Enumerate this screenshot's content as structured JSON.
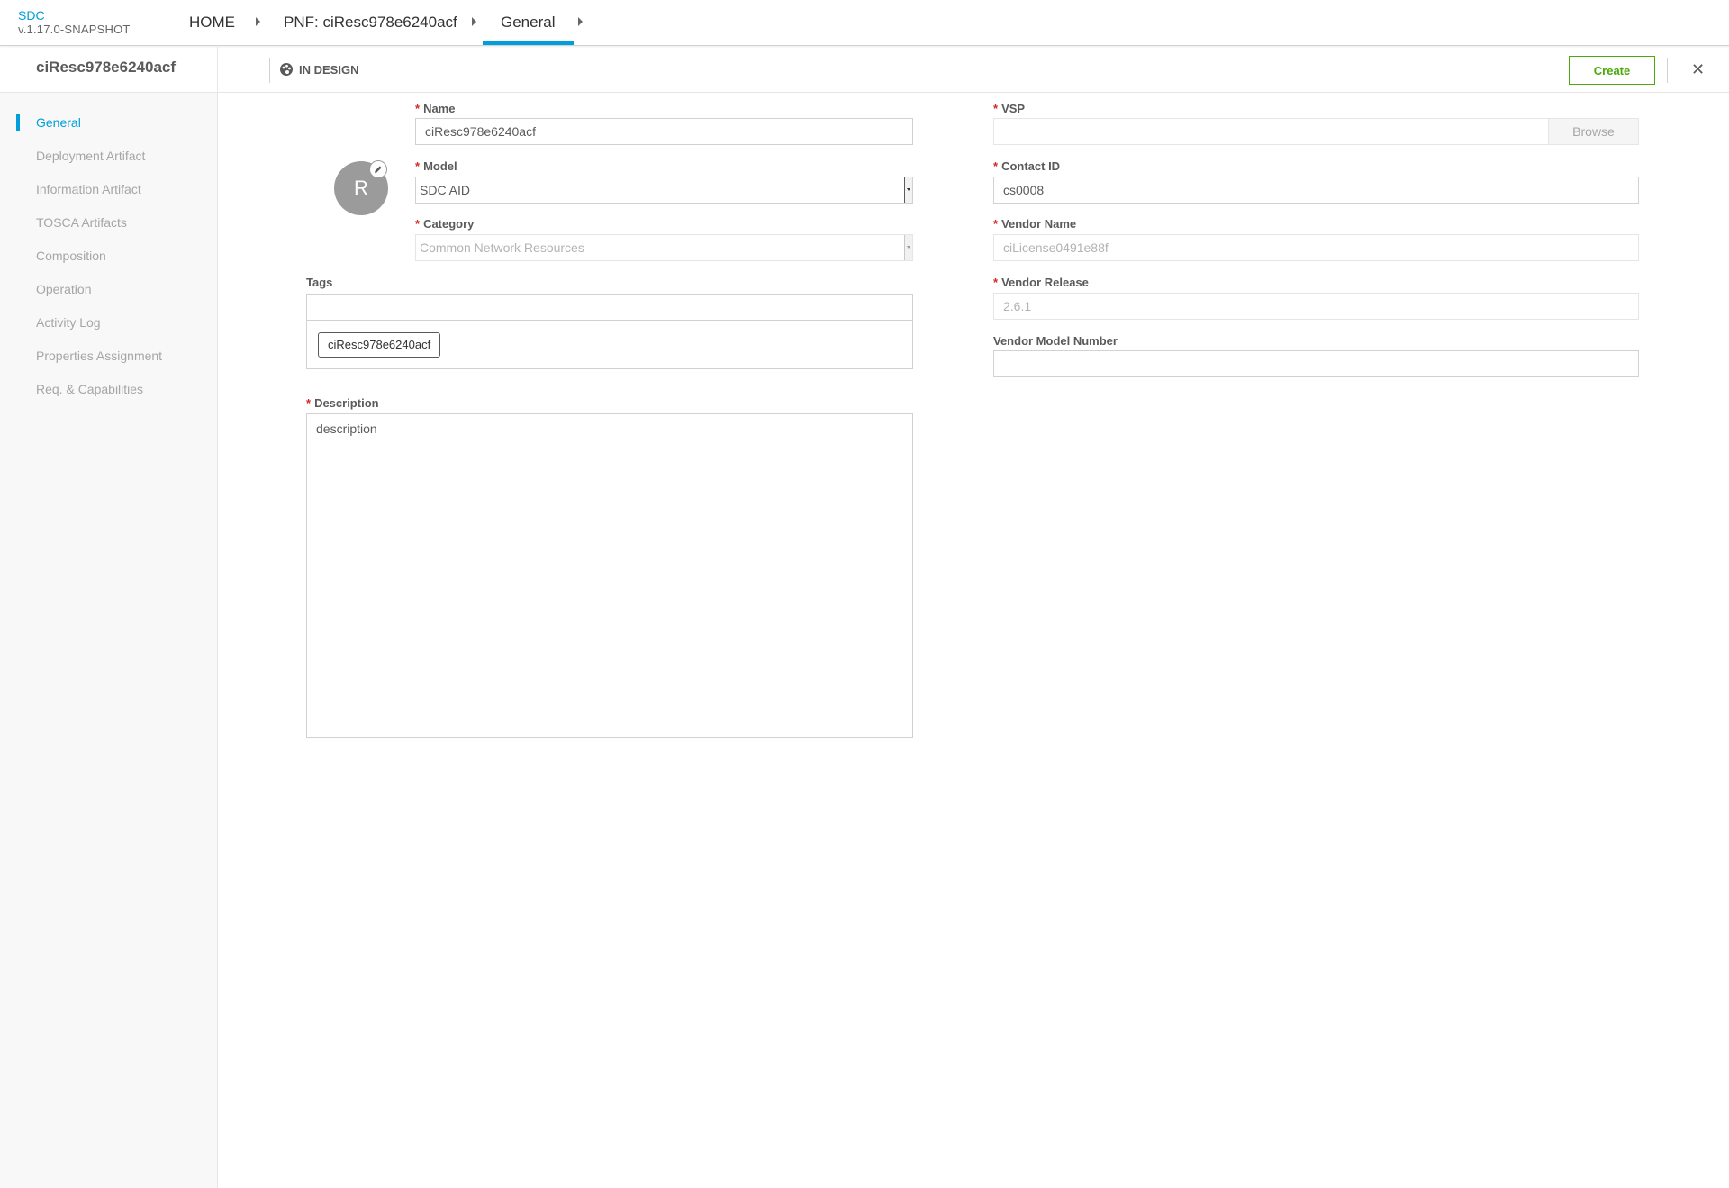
{
  "header": {
    "brand": "SDC",
    "version": "v.1.17.0-SNAPSHOT",
    "breadcrumbs": [
      "HOME",
      "PNF: ciResc978e6240acf",
      "General"
    ]
  },
  "subheader": {
    "resource_name": "ciResc978e6240acf",
    "status": "IN DESIGN",
    "create_label": "Create",
    "close_icon": "close-icon"
  },
  "sidebar": {
    "items": [
      {
        "label": "General",
        "active": true
      },
      {
        "label": "Deployment Artifact"
      },
      {
        "label": "Information Artifact"
      },
      {
        "label": "TOSCA Artifacts"
      },
      {
        "label": "Composition"
      },
      {
        "label": "Operation"
      },
      {
        "label": "Activity Log"
      },
      {
        "label": "Properties Assignment"
      },
      {
        "label": "Req. & Capabilities"
      }
    ]
  },
  "form": {
    "avatar_letter": "R",
    "name": {
      "label": "Name",
      "value": "ciResc978e6240acf"
    },
    "model": {
      "label": "Model",
      "value": "SDC AID"
    },
    "category": {
      "label": "Category",
      "value": "Common Network Resources"
    },
    "tags": {
      "label": "Tags",
      "chips": [
        "ciResc978e6240acf"
      ]
    },
    "description": {
      "label": "Description",
      "value": "description"
    },
    "vsp": {
      "label": "VSP",
      "value": "",
      "browse_label": "Browse"
    },
    "contact_id": {
      "label": "Contact ID",
      "value": "cs0008"
    },
    "vendor_name": {
      "label": "Vendor Name",
      "value": "ciLicense0491e88f"
    },
    "vendor_release": {
      "label": "Vendor Release",
      "value": "2.6.1"
    },
    "vendor_model_number": {
      "label": "Vendor Model Number",
      "value": ""
    }
  },
  "colors": {
    "accent": "#009fdb",
    "create": "#4ca90c",
    "required": "#cf2a2a"
  }
}
